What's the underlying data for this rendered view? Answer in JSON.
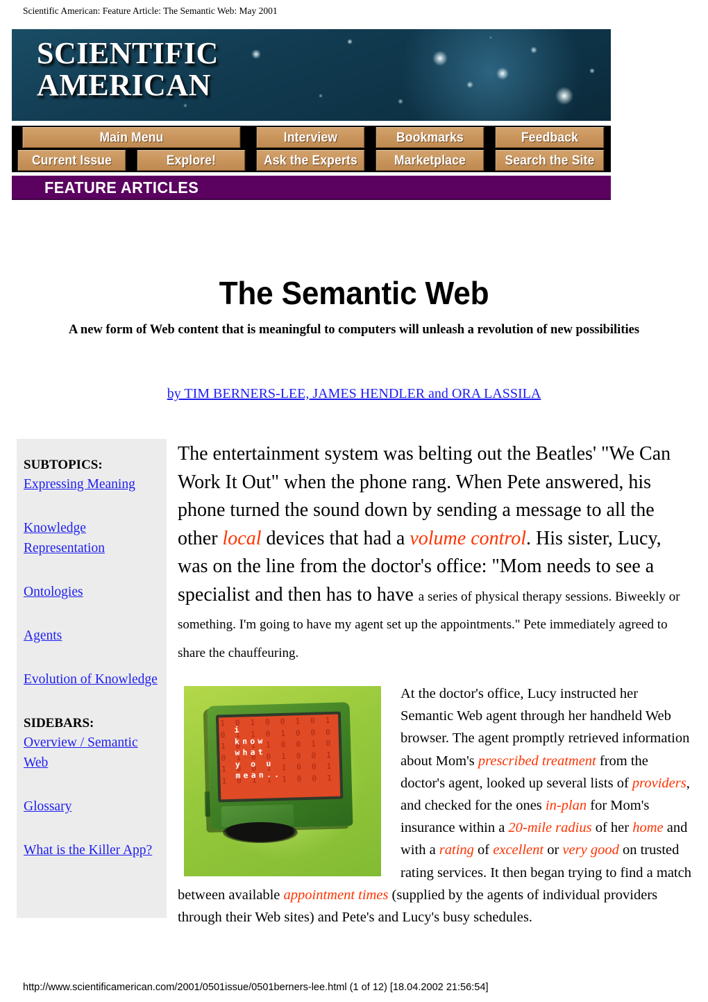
{
  "page_header": "Scientific American: Feature Article: The Semantic Web: May 2001",
  "masthead": {
    "logo_line1": "SCIENTIFIC",
    "logo_line2": "AMERICAN",
    "nav_row1": [
      {
        "label": "Main Menu",
        "width": "w2"
      },
      {
        "label": "Interview",
        "width": "w1"
      },
      {
        "label": "Bookmarks",
        "width": "w1"
      },
      {
        "label": "Feedback",
        "width": "w3"
      }
    ],
    "nav_row2": [
      {
        "label": "Current Issue",
        "width": "w1"
      },
      {
        "label": "Explore!",
        "width": "w1"
      },
      {
        "label": "Ask the Experts",
        "width": "w1"
      },
      {
        "label": "Marketplace",
        "width": "w1"
      },
      {
        "label": "Search the Site",
        "width": "w3"
      }
    ],
    "section_bar": "FEATURE ARTICLES",
    "section_bar_color": "#5b0160",
    "nav_button_color": "#c9955d"
  },
  "article": {
    "title": "The Semantic Web",
    "deck": "A new form of Web content that is meaningful to computers will unleash a revolution of new possibilities",
    "byline": "by TIM BERNERS-LEE, JAMES HENDLER and ORA LASSILA",
    "link_color": "#1d1df0",
    "highlight_color": "#ff3300"
  },
  "sidebar": {
    "background": "#ececec",
    "subtopics_heading": "SUBTOPICS:",
    "subtopics": [
      "Expressing Meaning",
      "Knowledge Representation",
      "Ontologies",
      "Agents",
      "Evolution of Knowledge"
    ],
    "sidebars_heading": "SIDEBARS:",
    "sidebars": [
      "Overview / Semantic Web",
      "Glossary",
      "What is the Killer App?"
    ]
  },
  "body": {
    "lede": {
      "big_1": "The entertainment system was belting out the Beatles' \"We Can Work It Out\" when the phone rang. When Pete answered, his phone turned the sound down by sending a message to all the other ",
      "hl_1": "local",
      "big_2": " devices that had a ",
      "hl_2": "volume control",
      "big_3": ". His sister, Lucy, was on the line from the doctor's office: \"Mom needs to see a specialist and then has to have ",
      "small_1": "a series of physical therapy sessions. Biweekly or something. I'm going to have my agent set up the appointments.\" Pete immediately agreed to share the chauffeuring."
    },
    "figure": {
      "alt": "Green computer monitor displaying an orange screen of binary digits",
      "screen_text": "i\nknow\nwhat  \ny o u\nmean..",
      "screen_binary": "1 0 1 0 0 1 0 1 1 1\n0 1 1 0 1 0 0 0 0 1\n1 0 1 1 0 0 1 0 1 0\n0 1 0 0 1 0 0 1 0 1\n1 0 0 1 1 0 0 1 0 1\n1 0 1 1 1 0 0 1 0 0",
      "screen_color": "#e04a25",
      "background_color": "#97c93c"
    },
    "wrapped": {
      "t1": "At the doctor's office, Lucy instructed her Semantic Web agent through her handheld Web browser. The agent promptly retrieved information about Mom's ",
      "h1": "prescribed treatment",
      "t2": " from the doctor's agent, looked up several lists of ",
      "h2": "providers",
      "t3": ", and checked for the ones ",
      "h3": "in-plan",
      "t4": " for Mom's insurance within a ",
      "h4": "20-mile radius",
      "t5": " of her ",
      "h5": "home",
      "t6": " and with a ",
      "h6": "rating",
      "t7": " of ",
      "h7": "excellent",
      "t8": " or ",
      "h8": "very good",
      "t9": " on trusted rating services. It then began trying to find a match between available ",
      "h9": "appointment times",
      "t10": " (supplied by the agents of individual providers through their Web sites) and Pete's and Lucy's busy schedules."
    }
  },
  "footer": "http://www.scientificamerican.com/2001/0501issue/0501berners-lee.html (1 of 12) [18.04.2002 21:56:54]"
}
